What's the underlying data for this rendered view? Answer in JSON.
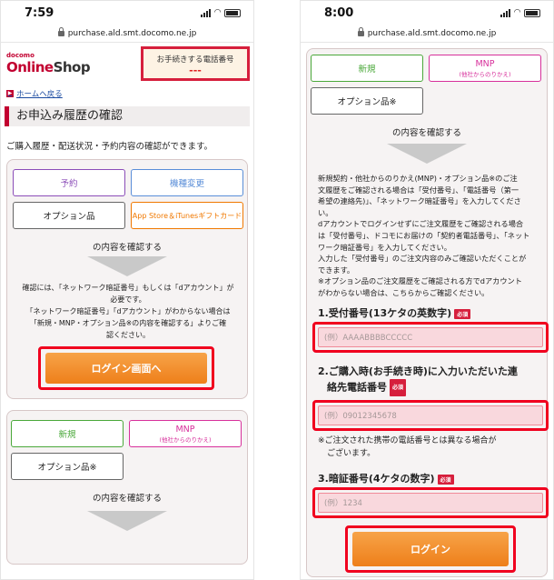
{
  "left": {
    "status": {
      "time": "7:59"
    },
    "url": "purchase.ald.smt.docomo.ne.jp",
    "logo_small": "docomo",
    "logo_main_a": "Online",
    "logo_main_b": "Shop",
    "phonebox": {
      "label": "お手続きする電話番号",
      "value": "---"
    },
    "home_link": "ホームへ戻る",
    "page_title": "お申込み履歴の確認",
    "lead": "ご購入履歴・配送状況・予約内容の確認ができます。",
    "card1": {
      "btn_reserve": "予約",
      "btn_model_change": "機種変更",
      "btn_option": "オプション品",
      "btn_appstore": "App Store＆iTunesギフトカード",
      "confirm": "の内容を確認する",
      "note1": "確認には、「ネットワーク暗証番号」もしくは「dアカウント」が",
      "note2": "必要です。",
      "note3": "「ネットワーク暗証番号」「dアカウント」がわからない場合は",
      "note4": "「新規・MNP・オプション品※の内容を確認する」よりご確",
      "note5": "認ください。",
      "login_btn": "ログイン画面へ"
    },
    "card2": {
      "btn_new": "新規",
      "btn_mnp": "MNP",
      "btn_mnp_sub": "(他社からのりかえ)",
      "btn_option": "オプション品※",
      "confirm": "の内容を確認する"
    }
  },
  "right": {
    "status": {
      "time": "8:00"
    },
    "url": "purchase.ald.smt.docomo.ne.jp",
    "btn_new": "新規",
    "btn_mnp": "MNP",
    "btn_mnp_sub": "(他社からのりかえ)",
    "btn_option": "オプション品※",
    "confirm": "の内容を確認する",
    "notes": [
      "新規契約・他社からのりかえ(MNP)・オプション品※のご注",
      "文履歴をご確認される場合は「受付番号」、「電話番号（第一",
      "希望の連絡先)」、「ネットワーク暗証番号」を入力してくださ",
      "い。",
      "dアカウントでログインせずにご注文履歴をご確認される場合",
      "は「受付番号」、ドコモにお届けの「契約者電話番号」、「ネット",
      "ワーク暗証番号」を入力してください。",
      "入力した「受付番号」のご注文内容のみご確認いただくことが",
      "できます。",
      "※オプション品のご注文履歴をご確認される方でdアカウント",
      "がわからない場合は、こちらからご確認ください。"
    ],
    "field1_label": "1.受付番号(13ケタの英数字)",
    "field1_placeholder": "(例）AAAABBBBCCCCC",
    "field2_label_a": "2.ご購入時(お手続き時)に入力いただいた連",
    "field2_label_b": "絡先電話番号",
    "field2_placeholder": "(例）09012345678",
    "field2_note_a": "※ご注文された携帯の電話番号とは異なる場合が",
    "field2_note_b": "ございます。",
    "field3_label": "3.暗証番号(4ケタの数字)",
    "field3_placeholder": "(例）1234",
    "required": "必須",
    "login_btn": "ログイン"
  }
}
